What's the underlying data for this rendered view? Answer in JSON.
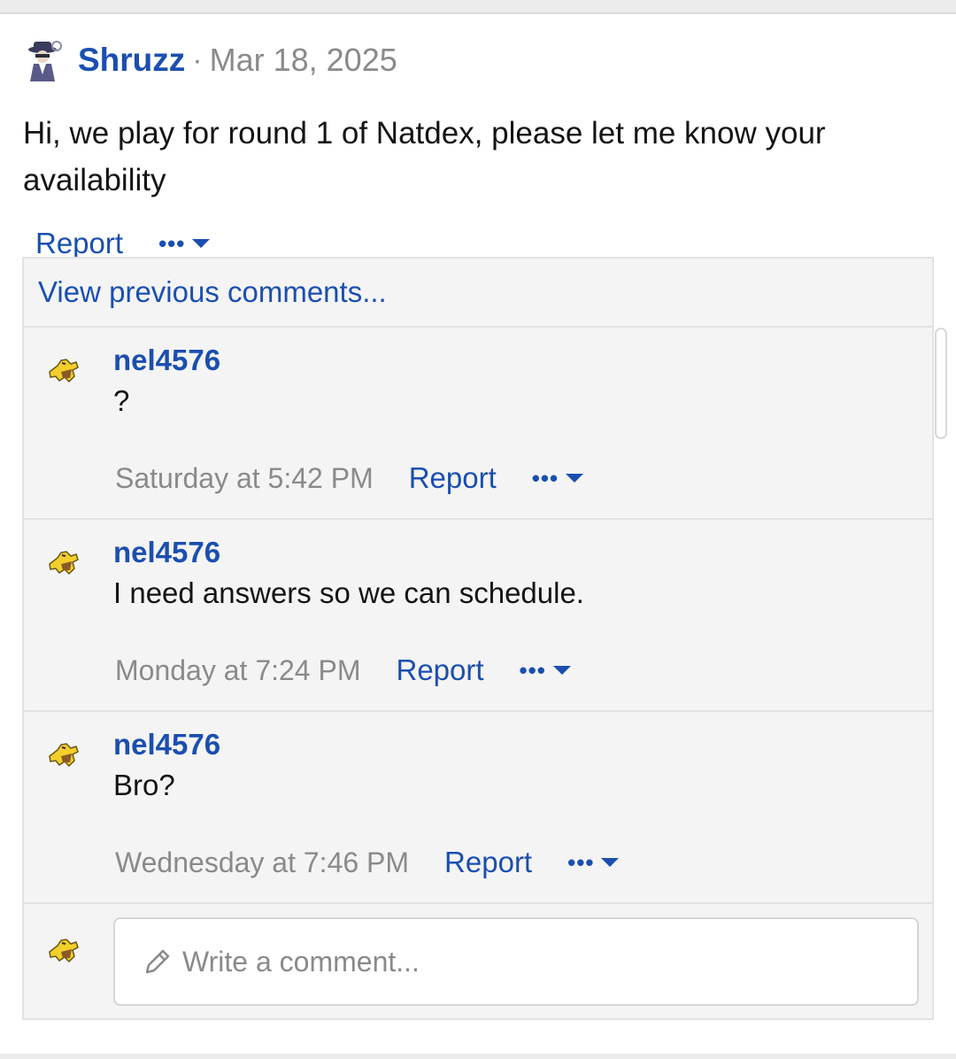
{
  "post": {
    "author": "Shruzz",
    "separator": "·",
    "date": "Mar 18, 2025",
    "body": "Hi, we play for round 1 of Natdex, please let me know your availability",
    "report_label": "Report",
    "more_label": "•••",
    "author_avatar_icon": "detective-avatar-icon"
  },
  "comments": {
    "view_previous": "View previous comments...",
    "items": [
      {
        "user": "nel4576",
        "text": "?",
        "time": "Saturday at 5:42 PM",
        "report": "Report",
        "more": "•••"
      },
      {
        "user": "nel4576",
        "text": "I need answers so we can schedule.",
        "time": "Monday at 7:24 PM",
        "report": "Report",
        "more": "•••"
      },
      {
        "user": "nel4576",
        "text": "Bro?",
        "time": "Wednesday at 7:46 PM",
        "report": "Report",
        "more": "•••"
      }
    ],
    "comment_avatar_icon": "abra-avatar-icon",
    "write_placeholder": "Write a comment..."
  },
  "colors": {
    "link": "#1a4fb0",
    "muted": "#8a8a8a",
    "text": "#141414",
    "panel": "#f4f4f4"
  }
}
